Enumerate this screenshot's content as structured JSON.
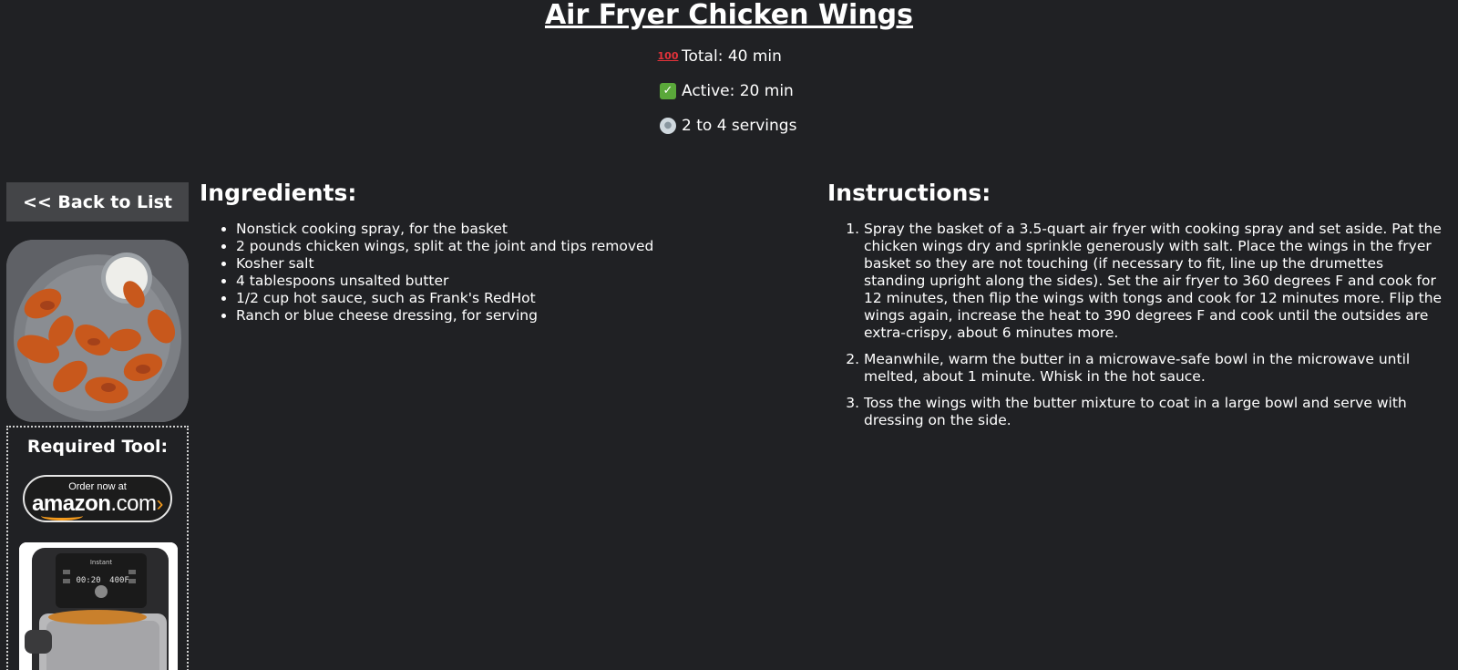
{
  "recipe": {
    "title": "Air Fryer Chicken Wings",
    "total": "Total: 40 min",
    "active": "Active: 20 min",
    "servings": "2 to 4 servings"
  },
  "icons": {
    "total": "hundred-points-emoji",
    "active": "check-mark-emoji",
    "servings": "plate-emoji"
  },
  "sidebar": {
    "back_label": "<< Back to List",
    "tool_title": "Required Tool:",
    "amazon_small": "Order now at",
    "amazon_logo": "amazon",
    "amazon_dot": ".com",
    "amazon_arrow": "›"
  },
  "ingredients": {
    "heading": "Ingredients:",
    "items": [
      "Nonstick cooking spray, for the basket",
      "2 pounds chicken wings, split at the joint and tips removed",
      "Kosher salt",
      "4 tablespoons unsalted butter",
      "1/2 cup hot sauce, such as Frank's RedHot",
      "Ranch or blue cheese dressing, for serving"
    ]
  },
  "instructions": {
    "heading": "Instructions:",
    "steps": [
      "Spray the basket of a 3.5-quart air fryer with cooking spray and set aside. Pat the chicken wings dry and sprinkle generously with salt. Place the wings in the fryer basket so they are not touching (if necessary to fit, line up the drumettes standing upright along the sides). Set the air fryer to 360 degrees F and cook for 12 minutes, then flip the wings with tongs and cook for 12 minutes more. Flip the wings again, increase the heat to 390 degrees F and cook until the outsides are extra-crispy, about 6 minutes more.",
      "Meanwhile, warm the butter in a microwave-safe bowl in the microwave until melted, about 1 minute. Whisk in the hot sauce.",
      "Toss the wings with the butter mixture to coat in a large bowl and serve with dressing on the side."
    ]
  },
  "colors": {
    "background": "#202124",
    "button": "#444548",
    "amazon_accent": "#f39a1c"
  }
}
